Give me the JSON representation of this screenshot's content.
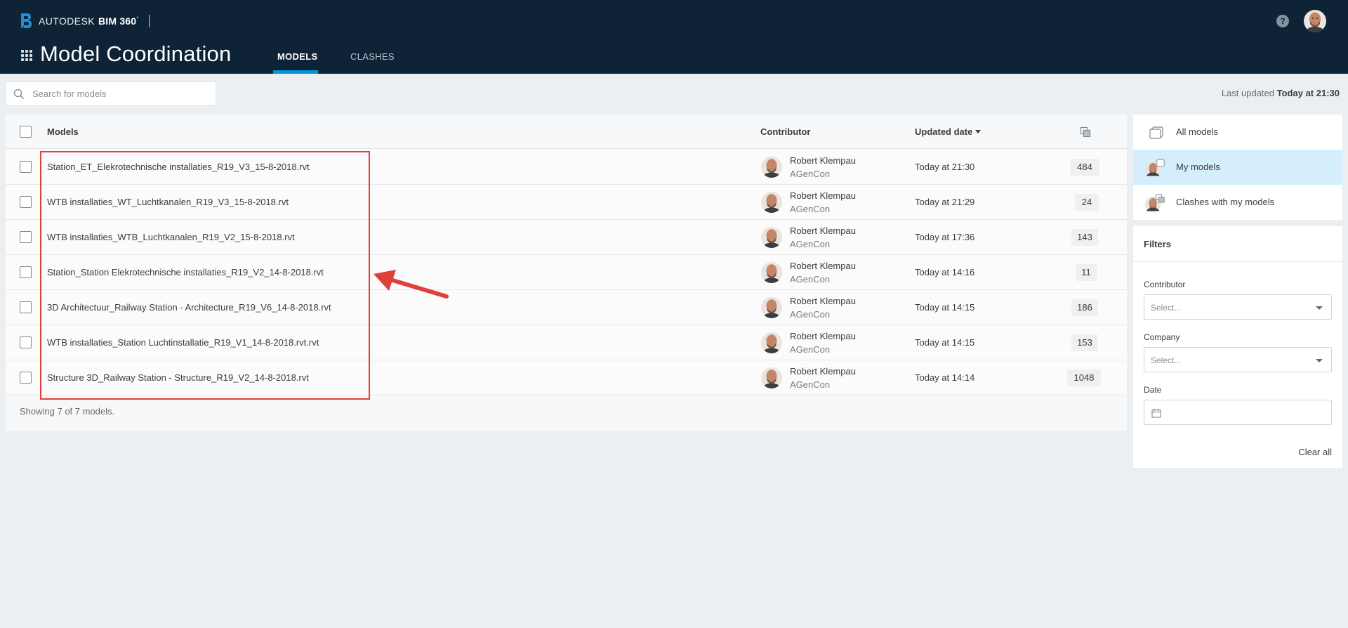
{
  "header": {
    "brand": "AUTODESK",
    "product": "BIM 360",
    "trademark": "°",
    "app_title": "Model Coordination",
    "help_label": "?",
    "tabs": [
      {
        "label": "MODELS",
        "active": true
      },
      {
        "label": "CLASHES",
        "active": false
      }
    ]
  },
  "search": {
    "placeholder": "Search for models",
    "value": ""
  },
  "last_updated": {
    "label": "Last updated",
    "value": "Today at 21:30"
  },
  "table": {
    "columns": {
      "models": "Models",
      "contributor": "Contributor",
      "updated_date": "Updated date"
    },
    "rows": [
      {
        "name": "Station_ET_Elekrotechnische installaties_R19_V3_15-8-2018.rvt",
        "contributor": "Robert Klempau",
        "company": "AGenCon",
        "date": "Today at 21:30",
        "clashes": "484"
      },
      {
        "name": "WTB installaties_WT_Luchtkanalen_R19_V3_15-8-2018.rvt",
        "contributor": "Robert Klempau",
        "company": "AGenCon",
        "date": "Today at 21:29",
        "clashes": "24"
      },
      {
        "name": "WTB installaties_WTB_Luchtkanalen_R19_V2_15-8-2018.rvt",
        "contributor": "Robert Klempau",
        "company": "AGenCon",
        "date": "Today at 17:36",
        "clashes": "143"
      },
      {
        "name": "Station_Station Elekrotechnische installaties_R19_V2_14-8-2018.rvt",
        "contributor": "Robert Klempau",
        "company": "AGenCon",
        "date": "Today at 14:16",
        "clashes": "11"
      },
      {
        "name": "3D Architectuur_Railway Station - Architecture_R19_V6_14-8-2018.rvt",
        "contributor": "Robert Klempau",
        "company": "AGenCon",
        "date": "Today at 14:15",
        "clashes": "186"
      },
      {
        "name": "WTB installaties_Station Luchtinstallatie_R19_V1_14-8-2018.rvt.rvt",
        "contributor": "Robert Klempau",
        "company": "AGenCon",
        "date": "Today at 14:15",
        "clashes": "153"
      },
      {
        "name": "Structure 3D_Railway Station - Structure_R19_V2_14-8-2018.rvt",
        "contributor": "Robert Klempau",
        "company": "AGenCon",
        "date": "Today at 14:14",
        "clashes": "1048"
      }
    ],
    "footer": "Showing 7 of 7 models."
  },
  "views": [
    {
      "label": "All models",
      "selected": false
    },
    {
      "label": "My models",
      "selected": true
    },
    {
      "label": "Clashes with my models",
      "selected": false
    }
  ],
  "filters": {
    "title": "Filters",
    "contributor": {
      "label": "Contributor",
      "placeholder": "Select..."
    },
    "company": {
      "label": "Company",
      "placeholder": "Select..."
    },
    "date": {
      "label": "Date",
      "value": ""
    },
    "clear_all": "Clear all"
  },
  "colors": {
    "header_bg": "#0f2336",
    "accent": "#0696d7",
    "selected_bg": "#d4eefb",
    "annotation": "#e0403a"
  }
}
